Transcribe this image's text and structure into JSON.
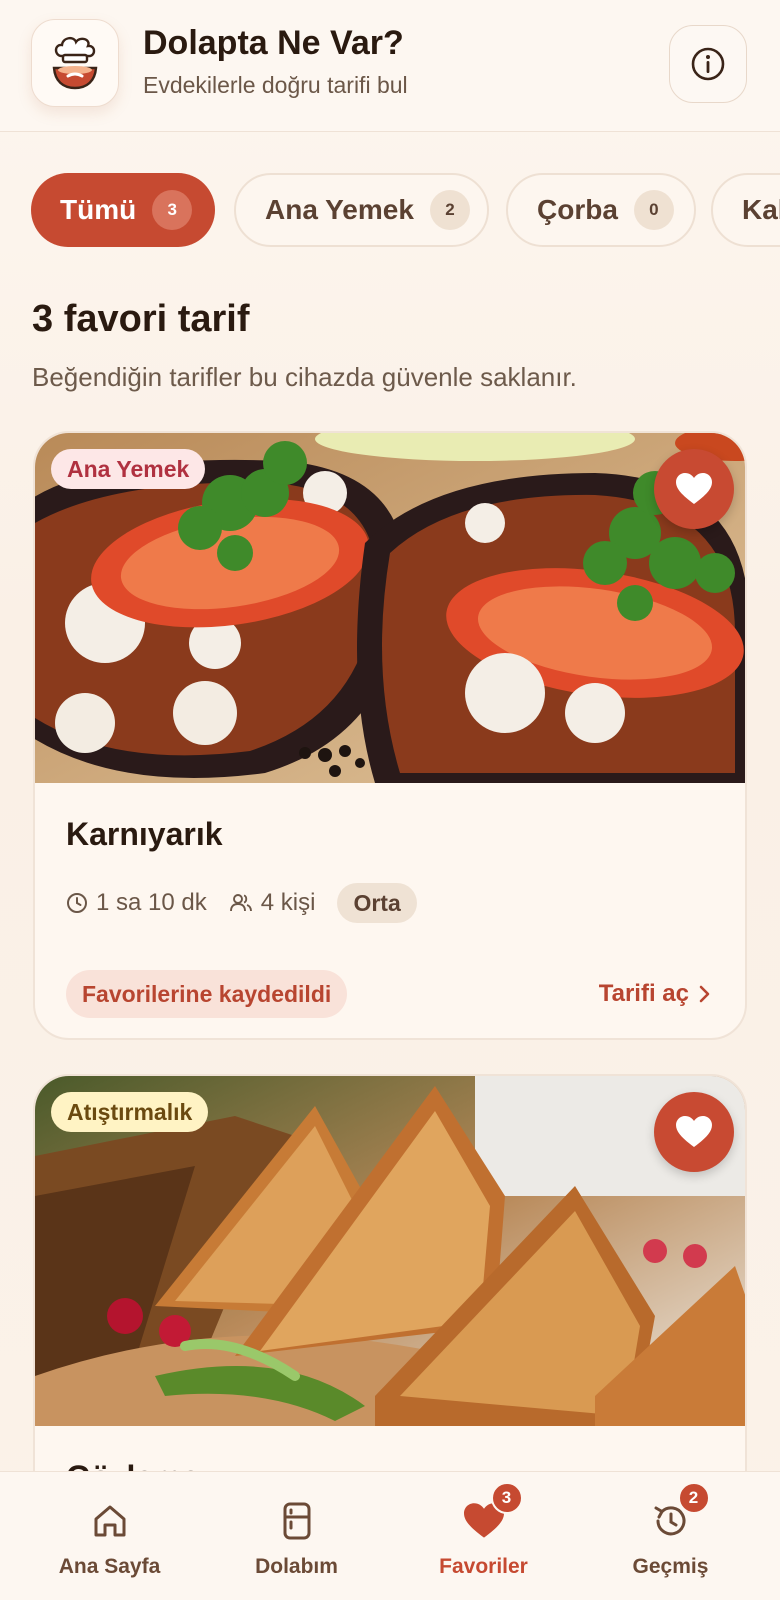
{
  "header": {
    "title": "Dolapta Ne Var?",
    "subtitle": "Evdekilerle doğru tarifi bul",
    "logo_icon": "chef-pot-icon",
    "info_icon": "info-icon"
  },
  "filters": [
    {
      "label": "Tümü",
      "count": "3",
      "active": true
    },
    {
      "label": "Ana Yemek",
      "count": "2",
      "active": false
    },
    {
      "label": "Çorba",
      "count": "0",
      "active": false
    },
    {
      "label": "Kahvaltı",
      "count": "",
      "active": false
    }
  ],
  "section": {
    "title": "3 favori tarif",
    "subtitle": "Beğendiğin tarifler bu cihazda güvenle saklanır."
  },
  "recipes": [
    {
      "category": "Ana Yemek",
      "name": "Karnıyarık",
      "time": "1 sa 10 dk",
      "servings": "4 kişi",
      "difficulty": "Orta",
      "saved_label": "Favorilerine kaydedildi",
      "open_label": "Tarifi aç"
    },
    {
      "category": "Atıştırmalık",
      "name": "Gözleme"
    }
  ],
  "bottom_nav": [
    {
      "label": "Ana Sayfa",
      "icon": "home-icon",
      "badge": "",
      "active": false
    },
    {
      "label": "Dolabım",
      "icon": "fridge-icon",
      "badge": "",
      "active": false
    },
    {
      "label": "Favoriler",
      "icon": "heart-icon",
      "badge": "3",
      "active": true
    },
    {
      "label": "Geçmiş",
      "icon": "history-icon",
      "badge": "2",
      "active": false
    }
  ],
  "colors": {
    "accent": "#c64a31",
    "background": "#fbf1e8",
    "text": "#2a1a10"
  }
}
